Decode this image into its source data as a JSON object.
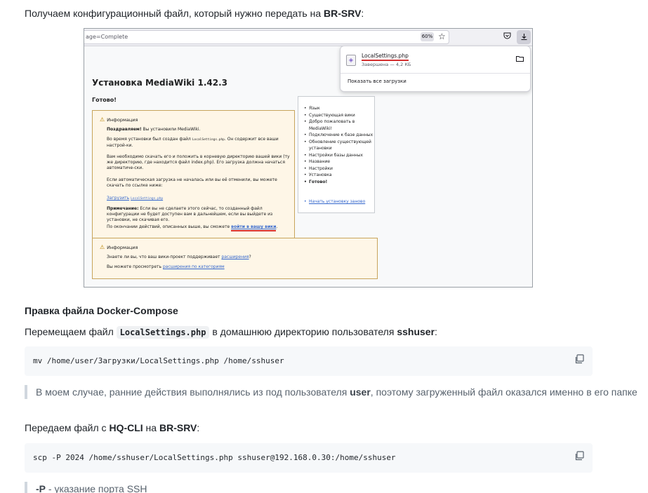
{
  "intro": {
    "text": "Получаем конфигурационный файл, который нужно передать на ",
    "target": "BR-SRV",
    "end": ":"
  },
  "browser": {
    "url_fragment": "age=Complete",
    "zoom": "60%",
    "download_panel": {
      "file_name": "LocalSettings.php",
      "status": "Завершена — 4,2 КБ",
      "show_all": "Показать все загрузки"
    }
  },
  "mediawiki": {
    "title": "Установка MediaWiki 1.42.3",
    "done": "Готово!",
    "info1": {
      "heading": "Информация",
      "congrats_bold": "Поздравляем!",
      "congrats_rest": " Вы установили MediaWiki.",
      "p2_a": "Во время установки был создан файл ",
      "p2_file": "LocalSettings.php",
      "p2_b": ". Он содержит все ваши настрой-ки.",
      "p3": "Вам необходимо скачать его и положить в корневую директорию вашей вики (ту же директорию, где находится файл index.php). Его загрузка должна начаться автоматиче-ски.",
      "p4": "Если автоматическая загрузка не началась или вы её отменили, вы можете скачать по ссылке ниже:",
      "download_link": "Загрузить",
      "download_file": "LocalSettings.php",
      "note_bold": "Примечание:",
      "note_rest": " Если вы не сделаете этого сейчас, то созданный файл конфигурации не будет доступен вам в дальнейшем, если вы выйдете из установки, не скачивая его.",
      "final_text": "По окончании действий, описанных выше, вы сможете ",
      "final_link": "войти в вашу вики",
      "final_end": "."
    },
    "info2": {
      "heading": "Информация",
      "line1_text": "Знаете ли вы, что ваш вики-проект поддерживает ",
      "line1_link": "расширения",
      "line1_end": "?",
      "line2_text": "Вы можете просмотреть ",
      "line2_link": "расширения по категориям"
    },
    "sidebar": {
      "items": [
        "Язык",
        "Существующая вики",
        "Добро пожаловать в MediaWiki!",
        "Подключение к базе данных",
        "Обновление существующей установки",
        "Настройки базы данных",
        "Название",
        "Настройки",
        "Установка",
        "Готово!"
      ],
      "restart": "Начать установку заново"
    }
  },
  "article": {
    "heading_docker": "Правка файла Docker-Compose",
    "move": {
      "before": "Перемещаем файл ",
      "file": "LocalSettings.php",
      "middle": " в домашнюю директорию пользователя ",
      "user": "sshuser",
      "end": ":"
    },
    "code1": "mv /home/user/Загрузки/LocalSettings.php /home/sshuser",
    "quote1": {
      "before": "В моем случае, ранние действия выполнялись из под пользователя ",
      "user": "user",
      "after": ", поэтому загруженный файл оказался именно в его папке"
    },
    "transfer": {
      "before": "Передаем файл с ",
      "from": "HQ-CLI",
      "middle": " на ",
      "to": "BR-SRV",
      "end": ":"
    },
    "code2": "scp -P 2024 /home/sshuser/LocalSettings.php sshuser@192.168.0.30:/home/sshuser",
    "quote2": {
      "flag": "-P",
      "rest": " - указание порта SSH"
    }
  }
}
